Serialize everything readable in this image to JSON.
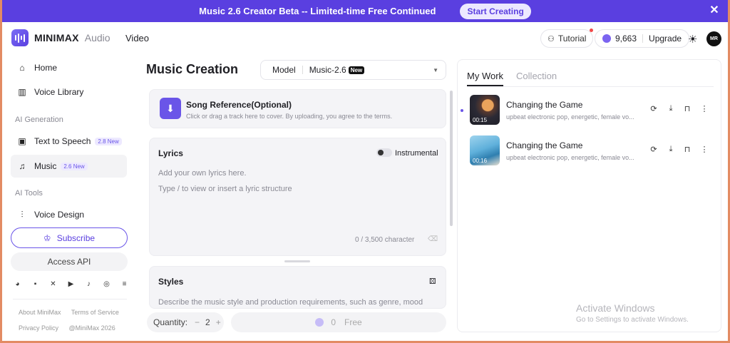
{
  "banner": {
    "text": "Music 2.6 Creator Beta -- Limited-time Free Continued",
    "cta": "Start Creating",
    "close_icon": "close-icon"
  },
  "header": {
    "logo_name": "MINIMAX",
    "logo_sub": "Audio",
    "nav_video": "Video",
    "tutorial": "Tutorial",
    "credits": "9,663",
    "upgrade": "Upgrade",
    "avatar_initials": "MR"
  },
  "sidebar": {
    "home": "Home",
    "voice_library": "Voice Library",
    "section_ai_generation": "AI Generation",
    "text_to_speech": "Text to Speech",
    "tts_tag": "2.8 New",
    "music": "Music",
    "music_tag": "2.6 New",
    "section_ai_tools": "AI Tools",
    "voice_design": "Voice Design",
    "subscribe": "Subscribe",
    "access_api": "Access API",
    "footer": {
      "about": "About MiniMax",
      "terms": "Terms of Service",
      "privacy": "Privacy Policy",
      "copyright": "@MiniMax 2026"
    }
  },
  "main": {
    "title": "Music Creation",
    "model_label": "Model",
    "model_value": "Music-2.6",
    "model_badge": "New",
    "song_ref_title": "Song Reference(Optional)",
    "song_ref_desc": "Click or drag a track here to cover. By uploading, you agree to the terms.",
    "lyrics_title": "Lyrics",
    "instrumental": "Instrumental",
    "lyrics_placeholder_1": "Add your own lyrics here.",
    "lyrics_placeholder_2": "Type / to view or insert a lyric structure",
    "char_count": "0 / 3,500 character",
    "styles_title": "Styles",
    "styles_placeholder": "Describe the music style and production requirements, such as genre, mood",
    "quantity_label": "Quantity:",
    "quantity_minus": "−",
    "quantity_value": "2",
    "quantity_plus": "+",
    "generate_cost": "0",
    "generate_label": "Free"
  },
  "right_panel": {
    "tabs": [
      "My Work",
      "Collection"
    ],
    "items": [
      {
        "name": "Changing the Game",
        "desc": "upbeat electronic pop, energetic, female vo...",
        "duration": "00:15"
      },
      {
        "name": "Changing the Game",
        "desc": "upbeat electronic pop, energetic, female vo...",
        "duration": "00:16"
      }
    ]
  },
  "watermark": {
    "line1": "Activate Windows",
    "line2": "Go to Settings to activate Windows."
  },
  "colors": {
    "accent": "#5a3fe0",
    "banner_bg": "#5a3fe0",
    "window_border": "#e38b63"
  }
}
